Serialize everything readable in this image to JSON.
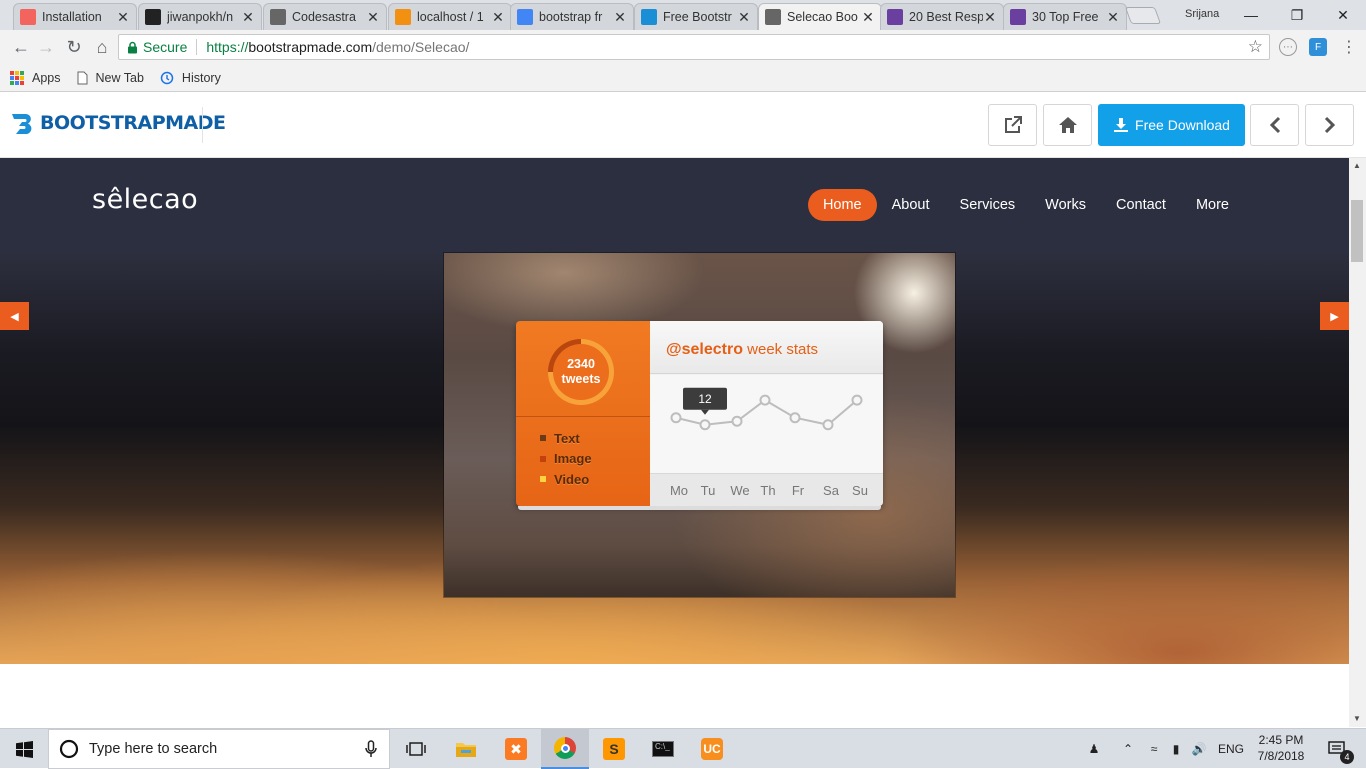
{
  "browser": {
    "tabs": [
      {
        "title": "Installation",
        "favicon": "laravel-icon",
        "color": "#f4645f"
      },
      {
        "title": "jiwanpokh/n",
        "favicon": "github-icon",
        "color": "#222222"
      },
      {
        "title": "Codesastra",
        "favicon": "page-icon",
        "color": "#666666"
      },
      {
        "title": "localhost / 1",
        "favicon": "phpmyadmin-icon",
        "color": "#f29111"
      },
      {
        "title": "bootstrap fr",
        "favicon": "google-icon",
        "color": "#4285f4"
      },
      {
        "title": "Free Bootstr",
        "favicon": "bootstrapmade-icon",
        "color": "#1b8fd6"
      },
      {
        "title": "Selecao Boo",
        "favicon": "page-icon",
        "color": "#666666"
      },
      {
        "title": "20 Best Resp",
        "favicon": "colorlib-icon",
        "color": "#6b3fa0"
      },
      {
        "title": "30 Top Free",
        "favicon": "colorlib-icon",
        "color": "#6b3fa0"
      }
    ],
    "user": "Srijana",
    "secure_label": "Secure",
    "url": {
      "protocol": "https://",
      "host": "bootstrapmade.com",
      "path": "/demo/Selecao/"
    },
    "bookmarks": [
      {
        "label": "Apps",
        "icon": "apps-grid-icon"
      },
      {
        "label": "New Tab",
        "icon": "page-icon"
      },
      {
        "label": "History",
        "icon": "history-icon"
      }
    ]
  },
  "bm_bar": {
    "logo": "BOOTSTRAPMADE",
    "download_label": "Free Download",
    "accent": "#12a0e8"
  },
  "site": {
    "logo": "sêlecao",
    "nav": [
      "Home",
      "About",
      "Services",
      "Works",
      "Contact",
      "More"
    ],
    "active_nav": "Home",
    "accent": "#eb5d1e"
  },
  "widget": {
    "count": "2340",
    "count_label": "tweets",
    "legend": [
      {
        "label": "Text",
        "color": "#6b3a16"
      },
      {
        "label": "Image",
        "color": "#c2410c"
      },
      {
        "label": "Video",
        "color": "#ffd23f"
      }
    ],
    "handle": "@selectro",
    "heading_rest": "week stats",
    "tooltip": "12",
    "chart_data": {
      "type": "line",
      "categories": [
        "Mo",
        "Tu",
        "We",
        "Th",
        "Fr",
        "Sa",
        "Su"
      ],
      "values": [
        14,
        12,
        13,
        19,
        14,
        12,
        19
      ],
      "ylim": [
        0,
        25
      ]
    }
  },
  "taskbar": {
    "search_placeholder": "Type here to search",
    "lang": "ENG",
    "time": "2:45 PM",
    "date": "7/8/2018",
    "notifications": "4"
  }
}
